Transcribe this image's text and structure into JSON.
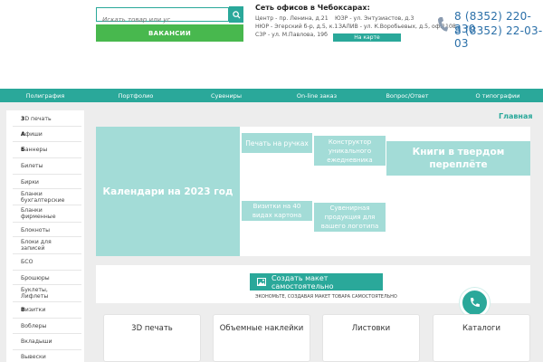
{
  "header": {
    "search_placeholder": "Искать товар или ус",
    "vacancies_label": "ВАКАНСИИ",
    "offices_title": "Сеть офисов в Чебоксарах:",
    "offices": [
      "Центр - пр. Ленина, д.21",
      "ЮЗР - ул. Энтузиастов, д.3",
      "НЮР - Эгерский б-р, д.5, к.1",
      "ЗАЛИВ - ул. К.Воробьевых, д.5, оф.1108",
      "СЗР - ул. М.Павлова, 19б"
    ],
    "map_label": "На карте",
    "phones": [
      "8 (8352) 220-330",
      "8 (8352) 22-03-03"
    ]
  },
  "nav": {
    "items": [
      "Полиграфия",
      "Портфолио",
      "Сувениры",
      "On-line заказ",
      "Вопрос/Ответ",
      "О типографии"
    ]
  },
  "sidebar": {
    "items": [
      {
        "first": "3",
        "rest": "D печать"
      },
      {
        "first": "А",
        "rest": "фиши"
      },
      {
        "first": "Б",
        "rest": "аннеры"
      },
      {
        "first": "",
        "rest": "Билеты"
      },
      {
        "first": "",
        "rest": "Бирки"
      },
      {
        "first": "",
        "rest": "Бланки бухгалтерские"
      },
      {
        "first": "",
        "rest": "Бланки фирменные"
      },
      {
        "first": "",
        "rest": "Блокноты"
      },
      {
        "first": "",
        "rest": "Блоки для записей"
      },
      {
        "first": "",
        "rest": "БСО"
      },
      {
        "first": "",
        "rest": "Брошюры"
      },
      {
        "first": "",
        "rest": "Буклеты, Лифлеты"
      },
      {
        "first": "В",
        "rest": "изитки"
      },
      {
        "first": "",
        "rest": "Воблеры"
      },
      {
        "first": "",
        "rest": "Вкладыши"
      },
      {
        "first": "",
        "rest": "Вывески"
      }
    ]
  },
  "breadcrumb": {
    "home": "Главная"
  },
  "tiles": {
    "calendars": "Календари на 2023 год",
    "pen_print": "Печать на ручках",
    "constructor": "Конструктор уникального ежедневника",
    "books": "Книги в твердом переплёте",
    "business_cards": "Визитки на 40 видах картона",
    "souvenirs": "Сувенирная продукция для вашего логотипа"
  },
  "create": {
    "label": "Создать макет самостоятельно",
    "subtitle": "ЭКОНОМЬТЕ, СОЗДАВАЯ МАКЕТ ТОВАРА САМОСТОЯТЕЛЬНО"
  },
  "categories": [
    "3D печать",
    "Объемные наклейки",
    "Листовки",
    "Каталоги"
  ],
  "colors": {
    "accent": "#2aa89a",
    "green": "#48b84e",
    "tile": "#a3dcd7",
    "phone": "#2a6fa8"
  }
}
